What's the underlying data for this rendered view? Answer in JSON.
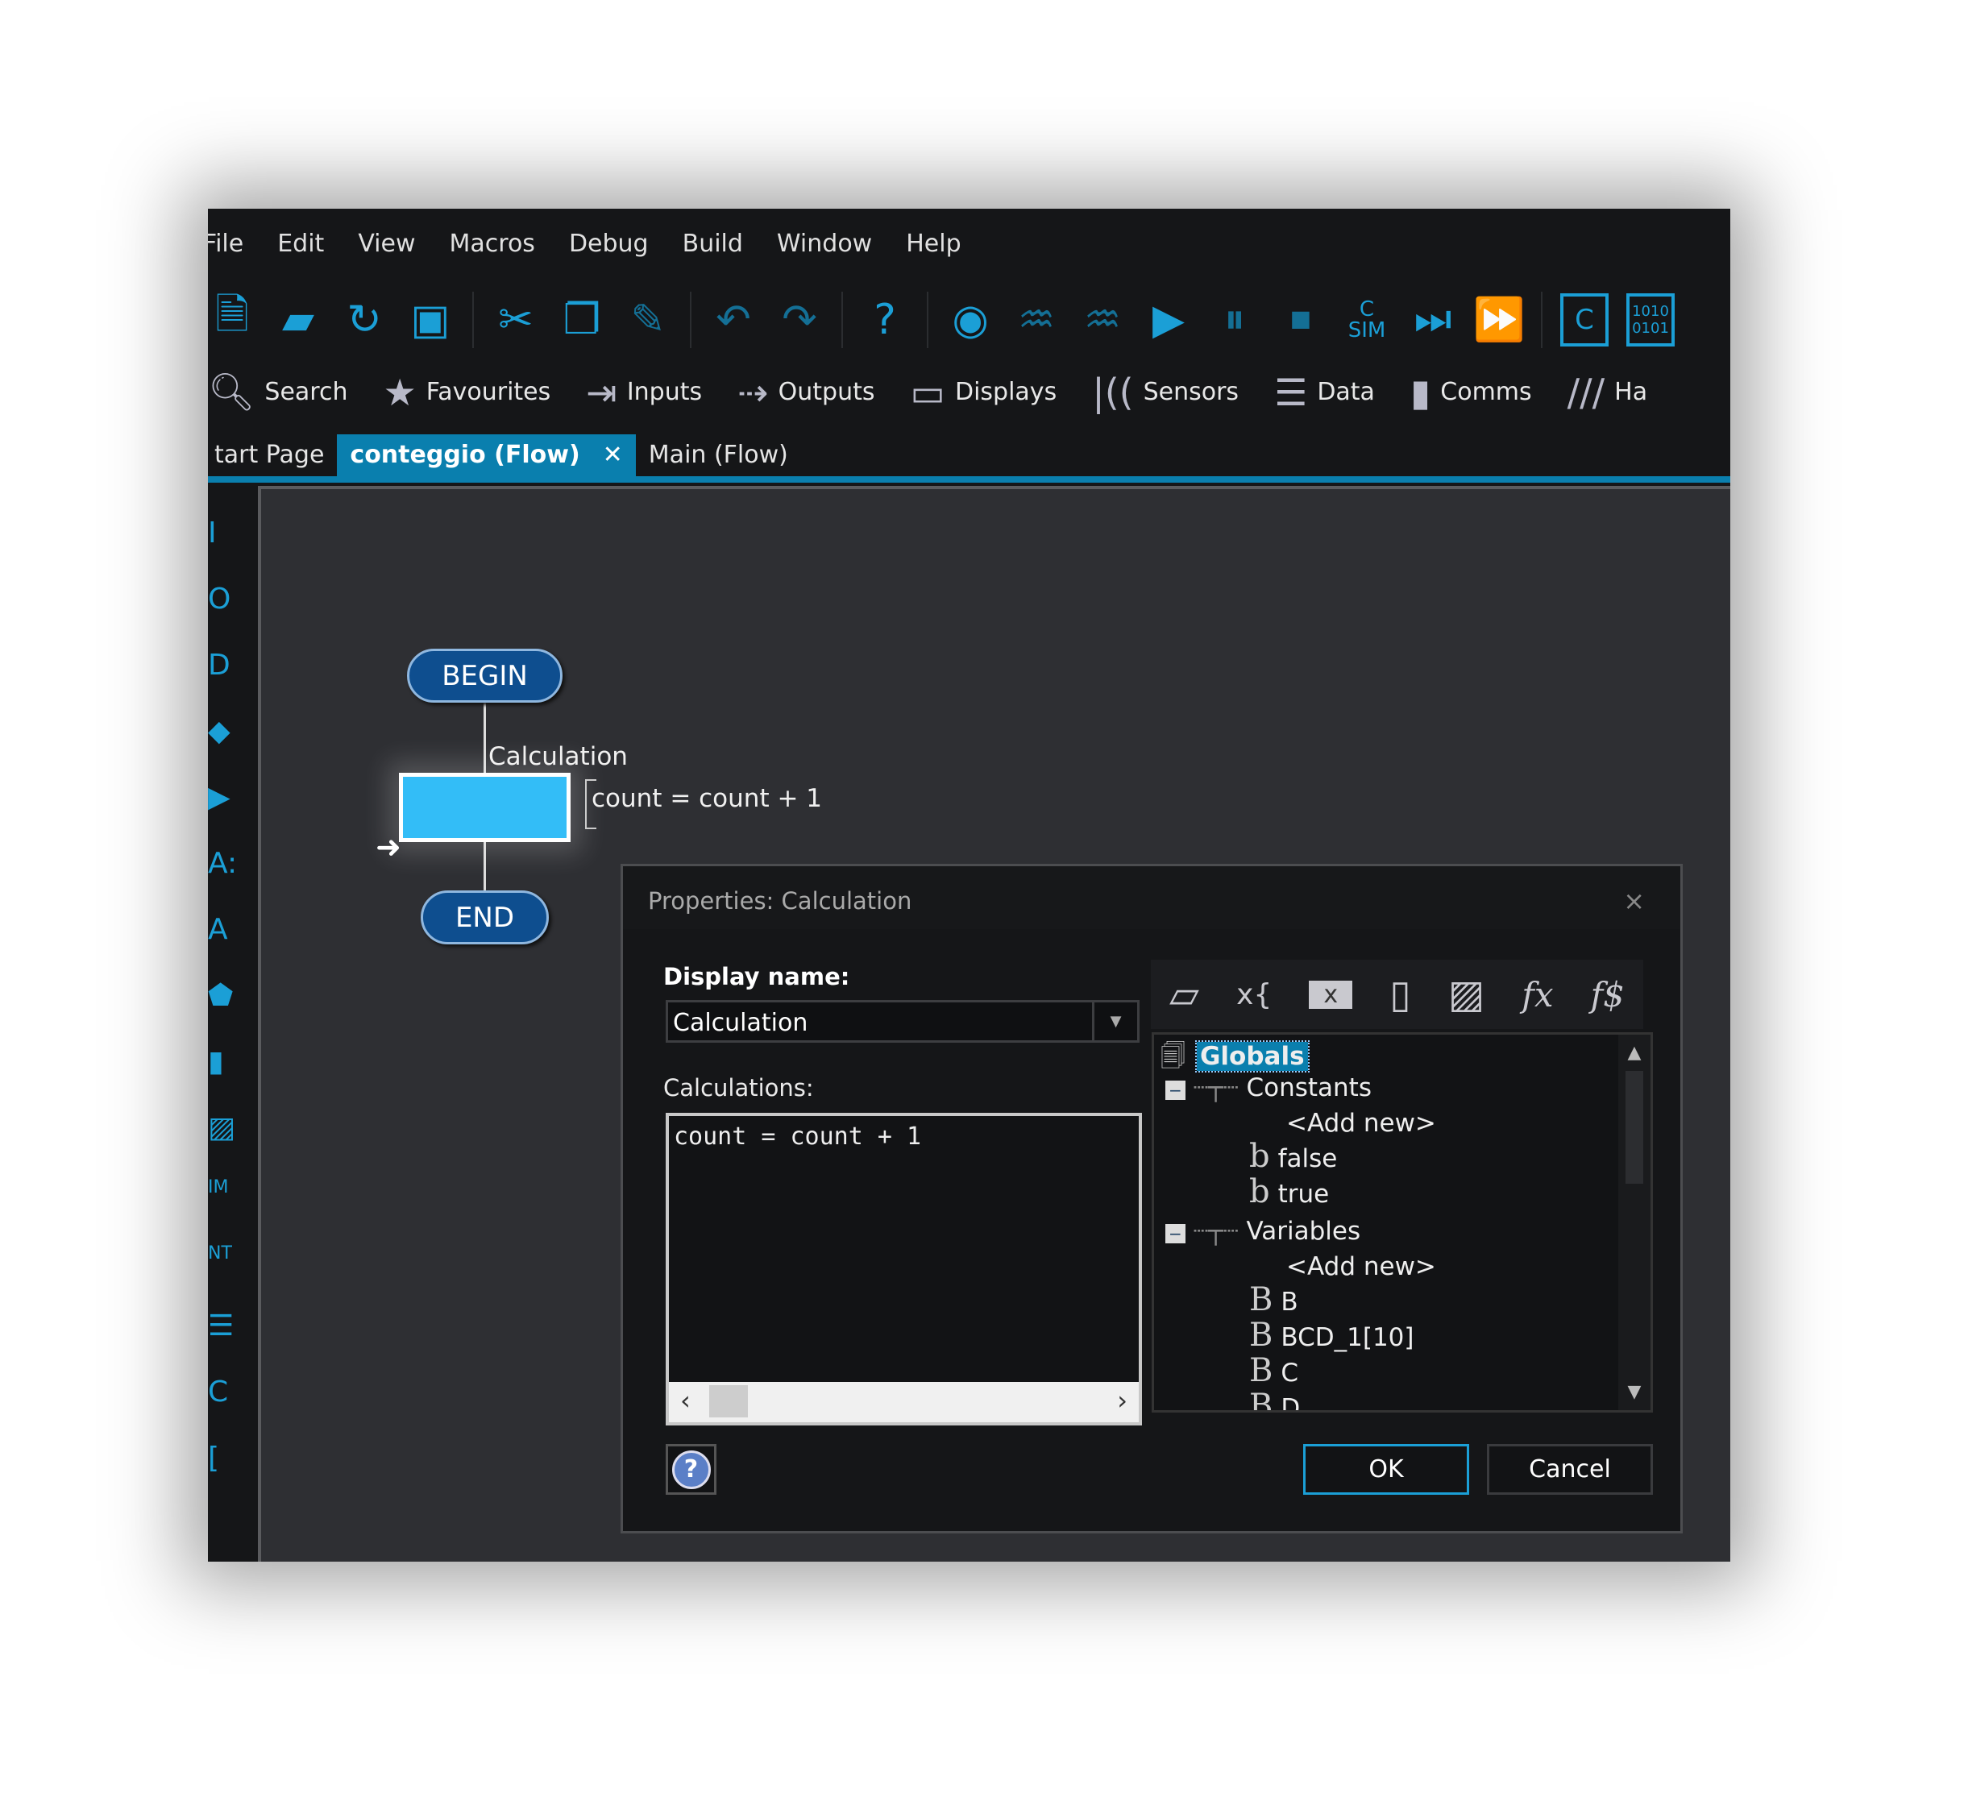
{
  "menu": [
    "File",
    "Edit",
    "View",
    "Macros",
    "Debug",
    "Build",
    "Window",
    "Help"
  ],
  "toolbar_icons": [
    "new-file-icon",
    "open-folder-icon",
    "refresh-icon",
    "save-icon",
    "cut-icon",
    "copy-icon",
    "paste-icon",
    "undo-icon",
    "redo-icon",
    "help-icon",
    "watch-icon",
    "ghost-icon",
    "ghost-off-icon",
    "play-icon",
    "pause-icon",
    "stop-icon",
    "c-sim-icon",
    "step-icon",
    "fast-forward-icon",
    "c-code-icon",
    "binary-icon"
  ],
  "toolbar_text": {
    "c_sim_top": "C",
    "c_sim_bottom": "SIM",
    "c_code": "C",
    "binary": "1010 0101"
  },
  "categories": [
    {
      "label": "Search",
      "icon": "search-icon"
    },
    {
      "label": "Favourites",
      "icon": "star-icon"
    },
    {
      "label": "Inputs",
      "icon": "inputs-icon"
    },
    {
      "label": "Outputs",
      "icon": "outputs-icon"
    },
    {
      "label": "Displays",
      "icon": "display-icon"
    },
    {
      "label": "Sensors",
      "icon": "sensors-icon"
    },
    {
      "label": "Data",
      "icon": "data-icon"
    },
    {
      "label": "Comms",
      "icon": "comms-icon"
    },
    {
      "label": "Ha",
      "icon": "hardware-icon"
    }
  ],
  "tabs": [
    {
      "label": "tart Page"
    },
    {
      "label": "conteggio (Flow)",
      "close": "✕"
    },
    {
      "label": "Main (Flow)"
    }
  ],
  "left_tools": [
    "I",
    "O",
    "D",
    "",
    "",
    "A:",
    "A",
    "",
    "",
    "",
    "IM",
    "NT",
    "",
    "C",
    "["
  ],
  "flow": {
    "begin": "BEGIN",
    "end": "END",
    "calc_label": "Calculation",
    "calc_code": "count = count + 1"
  },
  "dialog": {
    "title": "Properties: Calculation",
    "close": "×",
    "display_name_label": "Display name:",
    "display_name_value": "Calculation",
    "calculations_label": "Calculations:",
    "calculations_value": "count = count + 1",
    "ok": "OK",
    "cancel": "Cancel",
    "help": "?",
    "tools": [
      "▱",
      "x{",
      "x",
      "▯",
      "▨",
      "fx",
      "f$"
    ],
    "tree": {
      "root": "Globals",
      "constants": "Constants",
      "const_items": [
        {
          "icon": "b",
          "label": "<Add new>"
        },
        {
          "icon": "b",
          "label": "false"
        },
        {
          "icon": "b",
          "label": "true"
        }
      ],
      "variables": "Variables",
      "var_items": [
        {
          "icon": "B",
          "label": "<Add new>"
        },
        {
          "icon": "B",
          "label": "B"
        },
        {
          "icon": "B",
          "label": "BCD_1[10]"
        },
        {
          "icon": "B",
          "label": "C"
        },
        {
          "icon": "B",
          "label": "D"
        }
      ]
    }
  },
  "colors": {
    "accent": "#0a7fae",
    "icon_blue": "#1b9fd6",
    "calc_fill": "#33bdf7",
    "terminal": "#0e4e8f"
  }
}
